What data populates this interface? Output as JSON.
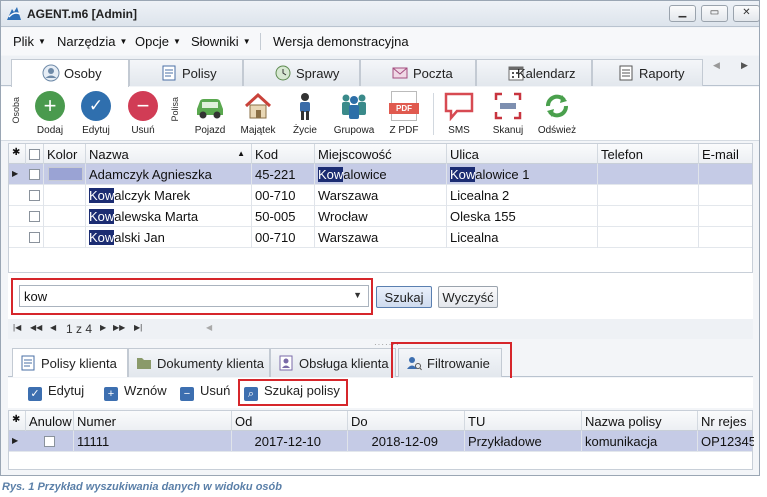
{
  "window": {
    "title": "AGENT.m6 [Admin]"
  },
  "menu": [
    "Plik",
    "Narzędzia",
    "Opcje",
    "Słowniki",
    "Wersja demonstracyjna"
  ],
  "main_tabs": [
    "Osoby",
    "Polisy",
    "Sprawy",
    "Poczta",
    "Kalendarz",
    "Raporty"
  ],
  "toolbar": {
    "group_osoba": "Osoba",
    "group_polisa": "Polisa",
    "dodaj": "Dodaj",
    "edytuj": "Edytuj",
    "usun": "Usuń",
    "pojazd": "Pojazd",
    "majatek": "Majątek",
    "zycie": "Życie",
    "grupowa": "Grupowa",
    "zpdf": "Z PDF",
    "pdf_badge": "PDF",
    "sms": "SMS",
    "skanuj": "Skanuj",
    "odswiez": "Odśwież"
  },
  "persons_grid": {
    "columns": [
      "Kolor",
      "Nazwa",
      "Kod",
      "Miejscowość",
      "Ulica",
      "Telefon",
      "E-mail"
    ],
    "rows": [
      {
        "name_hl": "",
        "name": "Adamczyk Agnieszka",
        "kod": "45-221",
        "miasto_hl": "Kow",
        "miasto": "alowice",
        "ulica_hl": "Kow",
        "ulica": "alowice 1",
        "selected": true
      },
      {
        "name_hl": "Kow",
        "name": "alczyk Marek",
        "kod": "00-710",
        "miasto_hl": "",
        "miasto": "Warszawa",
        "ulica_hl": "",
        "ulica": "Licealna 2",
        "selected": false
      },
      {
        "name_hl": "Kow",
        "name": "alewska Marta",
        "kod": "50-005",
        "miasto_hl": "",
        "miasto": "Wrocław",
        "ulica_hl": "",
        "ulica": "Oleska 155",
        "selected": false
      },
      {
        "name_hl": "Kow",
        "name": "alski Jan",
        "kod": "00-710",
        "miasto_hl": "",
        "miasto": "Warszawa",
        "ulica_hl": "",
        "ulica": "Licealna",
        "selected": false
      }
    ]
  },
  "search": {
    "value": "kow",
    "szukaj": "Szukaj",
    "wyczysc": "Wyczyść"
  },
  "pager": {
    "text": "1 z 4"
  },
  "bottom_tabs": [
    "Polisy klienta",
    "Dokumenty klienta",
    "Obsługa klienta",
    "Filtrowanie"
  ],
  "sub_toolbar": [
    "Edytuj",
    "Wznów",
    "Usuń",
    "Szukaj polisy"
  ],
  "policy_grid": {
    "columns": [
      "Anulow",
      "Numer",
      "Od",
      "Do",
      "TU",
      "Nazwa polisy",
      "Nr rejes"
    ],
    "rows": [
      {
        "numer": "11111",
        "od": "2017-12-10",
        "do": "2018-12-09",
        "tu": "Przykładowe",
        "nazwa": "komunikacja",
        "nr": "OP12345"
      }
    ]
  },
  "caption": "Rys. 1 Przykład wyszukiwania danych w widoku osób",
  "colors": {
    "highlight": "#1b2c72",
    "selected_row": "#c5cbe6",
    "red_frame": "#d6262b"
  }
}
